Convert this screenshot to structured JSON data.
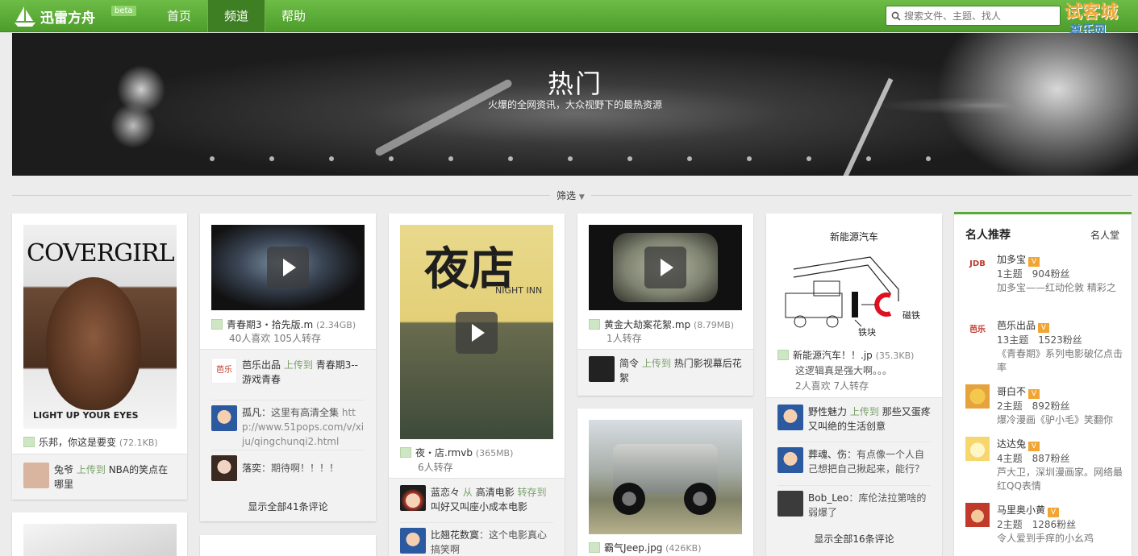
{
  "header": {
    "logo": "迅雷方舟",
    "beta": "beta",
    "nav": [
      "首页",
      "频道",
      "帮助"
    ],
    "search_placeholder": "搜索文件、主题、找人",
    "watermark_top": "试客城",
    "watermark_bottom": "尊乐网"
  },
  "banner": {
    "title": "热门",
    "subtitle": "火爆的全网资讯，大众视野下的最热资源"
  },
  "filter": "筛选",
  "col1": {
    "image_text_1": "COVERGIRL",
    "image_text_2": "LIGHT UP YOUR EYES",
    "file": "乐邦，你这是要变",
    "size": "(72.1KB)",
    "activity": {
      "user": "兔爷",
      "verb": "上传到",
      "target": "NBA的笑点在哪里"
    }
  },
  "col2": {
    "file": "青春期3・拾先版.m",
    "size": "(2.34GB)",
    "meta": "40人喜欢 105人转存",
    "activity": {
      "user": "芭乐出品",
      "verb": "上传到",
      "target": "青春期3--游戏青春",
      "avatar_text": "芭乐"
    },
    "comments": [
      {
        "user": "孤凡",
        "text": "：这里有高清全集 ",
        "url": "http://www.51pops.com/v/xiju/qingchunqi2.html"
      },
      {
        "user": "落奕",
        "text": "：期待啊！！！！",
        "url": ""
      }
    ],
    "show_all": "显示全部41条评论"
  },
  "col3": {
    "poster_title": "夜店",
    "poster_sub": "NIGHT INN",
    "file": "夜・店.rmvb",
    "size": "(365MB)",
    "meta": "6人转存",
    "activity": {
      "user": "蓝恋々",
      "verb": "从",
      "target": "高清电影",
      "verb2": "转存到",
      "target2": "叫好又叫座小成本电影"
    },
    "comments": [
      {
        "user": "比翘花数寞",
        "text": "：这个电影真心搞笑啊"
      }
    ]
  },
  "col4": {
    "file1": "黄金大劫案花絮.mp",
    "size1": "(8.79MB)",
    "meta1": "1人转存",
    "activity": {
      "user": "简令",
      "verb": "上传到",
      "target": "热门影视幕后花絮"
    },
    "file2": "霸气Jeep.jpg",
    "size2": "(426KB)"
  },
  "col5": {
    "diagram_title": "新能源汽车",
    "diagram_label_1": "磁铁",
    "diagram_label_2": "铁块",
    "file": "新能源汽车！！.jp",
    "size": "(35.3KB)",
    "desc": "这逻辑真是强大啊。。。",
    "meta": "2人喜欢 7人转存",
    "activity": {
      "user": "野性魅力",
      "verb": "上传到",
      "target": "那些又蛋疼又叫绝的生活创意"
    },
    "comments": [
      {
        "user": "葬魂、伤",
        "text": "：有点像一个人自己想把自己揪起来，能行？"
      },
      {
        "user": "Bob_Leo",
        "text": "：库伦法拉第啥的弱爆了"
      }
    ],
    "show_all": "显示全部16条评论"
  },
  "sidebar": {
    "title": "名人推荐",
    "more": "名人堂",
    "verified_mark": "V",
    "items": [
      {
        "name": "加多宝",
        "stats": "1主题　904粉丝",
        "desc": "加多宝——红动伦敦 精彩之",
        "logo": "JDB"
      },
      {
        "name": "芭乐出品",
        "stats": "13主题　1523粉丝",
        "desc": "《青春期》系列电影破亿点击率",
        "logo": "芭乐"
      },
      {
        "name": "哥白不",
        "stats": "2主题　892粉丝",
        "desc": "爆冷漫画《驴小毛》笑翻你"
      },
      {
        "name": "达达兔",
        "stats": "4主题　887粉丝",
        "desc": "芦大卫，深圳漫画家。网络最红QQ表情"
      },
      {
        "name": "马里奥小黄",
        "stats": "2主题　1286粉丝",
        "desc": "令人爱到手痒的小幺鸡"
      }
    ]
  }
}
